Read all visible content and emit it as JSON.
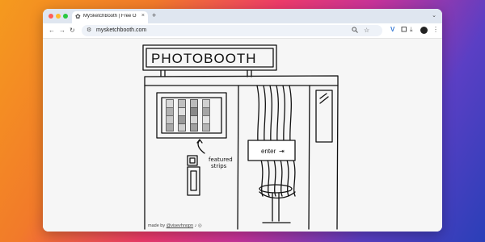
{
  "browser": {
    "tab_title": "MySketchBooth | Free Online",
    "tab_close": "×",
    "new_tab": "+",
    "tab_menu": "⌄",
    "url": "mysketchbooth.com",
    "nav_back": "←",
    "nav_forward": "→",
    "nav_reload": "↻"
  },
  "page": {
    "sign_title": "PHOTOBOOTH",
    "enter_label": "enter",
    "enter_icon": "⇥",
    "featured_label_line1": "featured",
    "featured_label_line2": "strips",
    "credit_prefix": "made by",
    "credit_handle": "@visevhnopn"
  },
  "icons": {
    "tab_icon": "sketch-photobooth-favicon",
    "site_settings": "tune-icon",
    "zoom": "magnifier-icon",
    "star": "star-icon",
    "extension": "v-extension-icon",
    "puzzle": "puzzle-icon",
    "download": "download-icon",
    "profile": "avatar-icon",
    "menu": "kebab-menu-icon"
  },
  "colors": {
    "accent_extension": "#3a7bd5"
  }
}
